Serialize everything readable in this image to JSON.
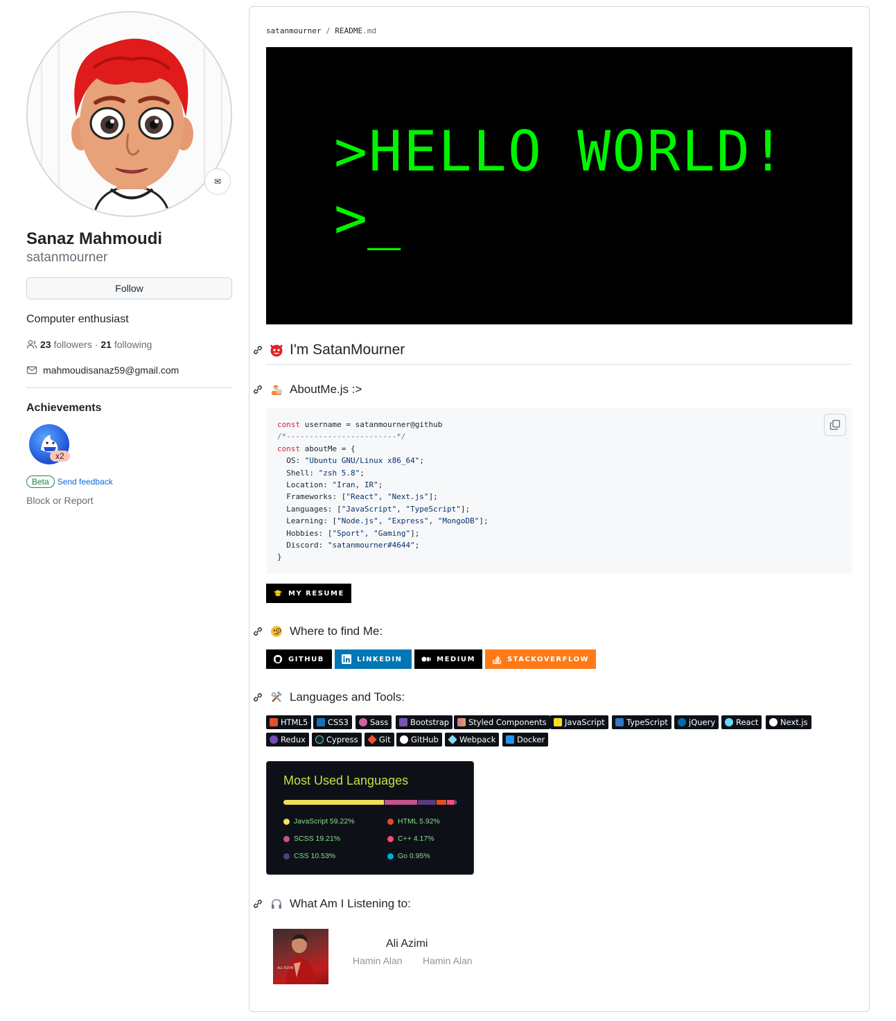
{
  "profile": {
    "name": "Sanaz Mahmoudi",
    "login": "satanmourner",
    "follow_label": "Follow",
    "bio": "Computer enthusiast",
    "followers_count": "23",
    "followers_label": "followers",
    "separator": "·",
    "following_count": "21",
    "following_label": "following",
    "email": "mahmoudisanaz59@gmail.com",
    "achievements_title": "Achievements",
    "achievement_multiplier": "x2",
    "beta_label": "Beta",
    "feedback_label": "Send feedback",
    "block_label": "Block or Report"
  },
  "readme": {
    "crumb_user": "satanmourner",
    "crumb_sep": "/",
    "crumb_file": "README",
    "crumb_ext": ".md",
    "banner_line1": ">HELLO WORLD!",
    "banner_line2": ">_",
    "heading_intro": "I'm SatanMourner",
    "heading_about": "AboutMe.js :>",
    "heading_where": "Where to find Me:",
    "heading_tools": "Languages and Tools:",
    "heading_listening": "What Am I Listening to:",
    "resume_label": "MY RESUME",
    "socials": [
      "GITHUB",
      "LINKEDIN",
      "MEDIUM",
      "STACKOVERFLOW"
    ],
    "tools_row1": [
      "HTML5",
      "CSS3",
      "Sass",
      "Bootstrap",
      "Styled Components",
      "JavaScript",
      "TypeScript",
      "jQuery",
      "React",
      "Next.js"
    ],
    "tools_row2": [
      "Redux",
      "Cypress",
      "Git",
      "GitHub",
      "Webpack",
      "Docker"
    ]
  },
  "code": {
    "l1_kw": "const",
    "l1_rest": " username = satanmourner@github",
    "l2": "/*------------------------*/",
    "l3_kw": "const",
    "l3_rest": " aboutMe = {",
    "os_key": "  OS: ",
    "os_val": "\"Ubuntu GNU/Linux x86_64\"",
    "shell_key": "  Shell: ",
    "shell_val": "\"zsh 5.8\"",
    "loc_key": "  Location: ",
    "loc_val": "\"Iran, IR\"",
    "fw_key": "  Frameworks: [",
    "fw_vals": "\"React\", \"Next.js\"",
    "lang_key": "  Languages: [",
    "lang_vals": "\"JavaScript\", \"TypeScript\"",
    "learn_key": "  Learning: [",
    "learn_vals": "\"Node.js\", \"Express\", \"MongoDB\"",
    "hob_key": "  Hobbies: [",
    "hob_vals": "\"Sport\", \"Gaming\"",
    "disc_key": "  Discord: ",
    "disc_val": "\"satanmourner#4644\"",
    "end": "}"
  },
  "languages_card": {
    "title": "Most Used Languages",
    "items": [
      {
        "name": "JavaScript",
        "percent": "59.22%",
        "color": "#f1e05a"
      },
      {
        "name": "SCSS",
        "percent": "19.21%",
        "color": "#c6538c"
      },
      {
        "name": "CSS",
        "percent": "10.53%",
        "color": "#563d7c"
      },
      {
        "name": "HTML",
        "percent": "5.92%",
        "color": "#e34c26"
      },
      {
        "name": "C++",
        "percent": "4.17%",
        "color": "#f34b7d"
      },
      {
        "name": "Go",
        "percent": "0.95%",
        "color": "#00add8"
      }
    ]
  },
  "now_playing": {
    "artist": "Ali Azimi",
    "track": "Hamin Alan",
    "album": "Hamin Alan",
    "cover_text": "ALI AZIMI"
  },
  "colors": {
    "accent_link": "#0969da",
    "banner_green": "#00f300",
    "linkedin": "#0077b5",
    "stackoverflow": "#fe7a16",
    "langs_title": "#c3e33e"
  }
}
